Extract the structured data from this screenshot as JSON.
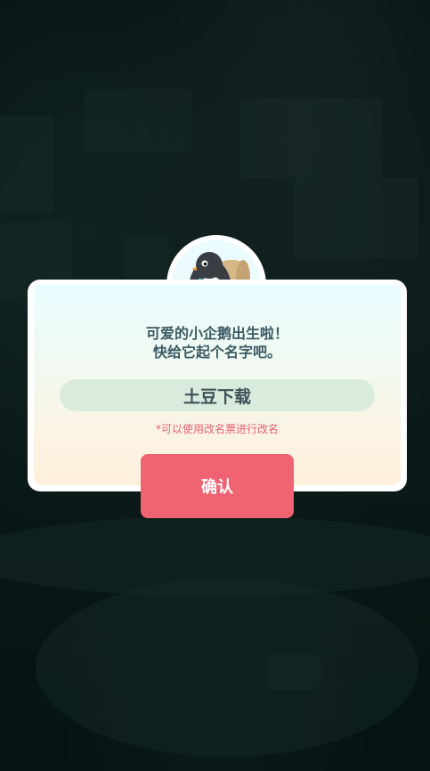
{
  "dialog": {
    "message_line1": "可爱的小企鹅出生啦！",
    "message_line2": "快给它起个名字吧。",
    "name_value": "土豆下载",
    "hint": "*可以使用改名票进行改名",
    "confirm_label": "确认"
  },
  "colors": {
    "confirm_button": "#ef6373",
    "hint_text": "#e65f6f",
    "message_text": "#3b5a63",
    "name_field_bg": "#d9ebdc"
  },
  "icons": {
    "avatar": "penguin-with-backpack-icon"
  }
}
